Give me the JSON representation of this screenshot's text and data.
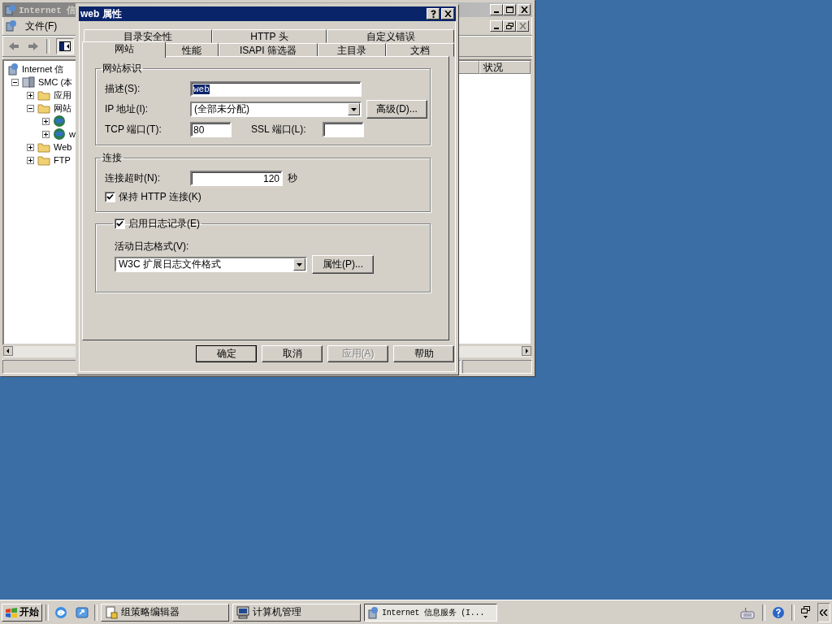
{
  "background_window": {
    "title": "Internet 信",
    "menu": [
      "文件(F)"
    ],
    "tree": [
      {
        "label": "Internet 信",
        "kind": "root",
        "children": [
          {
            "label": "SMC (本",
            "kind": "server",
            "expanded": true,
            "children": [
              {
                "label": "应用",
                "kind": "folder",
                "expanded": false
              },
              {
                "label": "网站",
                "kind": "folder",
                "expanded": true,
                "children": [
                  {
                    "kind": "site",
                    "expanded": false
                  },
                  {
                    "label": "w",
                    "kind": "site",
                    "expanded": false
                  }
                ]
              },
              {
                "label": "Web",
                "kind": "folder",
                "expanded": false
              },
              {
                "label": "FTP",
                "kind": "folder",
                "expanded": false
              }
            ]
          }
        ]
      }
    ],
    "columns": [
      "状况"
    ]
  },
  "dialog": {
    "title": "web 属性",
    "tab_rows": [
      [
        {
          "label": "目录安全性",
          "selected": false
        },
        {
          "label": "HTTP 头",
          "selected": false
        },
        {
          "label": "自定义错误",
          "selected": false
        }
      ],
      [
        {
          "label": "网站",
          "selected": true
        },
        {
          "label": "性能",
          "selected": false
        },
        {
          "label": "ISAPI 筛选器",
          "selected": false
        },
        {
          "label": "主目录",
          "selected": false
        },
        {
          "label": "文档",
          "selected": false
        }
      ]
    ],
    "site_identity": {
      "legend": "网站标识",
      "description_label": "描述(S):",
      "description_value": "web",
      "ip_label": "IP 地址(I):",
      "ip_value": "(全部未分配)",
      "advanced_button": "高级(D)...",
      "tcp_label": "TCP 端口(T):",
      "tcp_value": "80",
      "ssl_label": "SSL 端口(L):"
    },
    "connection": {
      "legend": "连接",
      "timeout_label": "连接超时(N):",
      "timeout_value": "120",
      "timeout_unit": "秒",
      "keepalive": {
        "label": "保持 HTTP 连接(K)",
        "checked": true
      }
    },
    "logging": {
      "enable": {
        "label": "启用日志记录(E)",
        "checked": true
      },
      "format_label": "活动日志格式(V):",
      "format_value": "W3C 扩展日志文件格式",
      "properties_button": "属性(P)..."
    },
    "buttons": [
      {
        "label": "确定",
        "default": true,
        "disabled": false
      },
      {
        "label": "取消",
        "default": false,
        "disabled": false
      },
      {
        "label": "应用(A)",
        "default": false,
        "disabled": true
      },
      {
        "label": "帮助",
        "default": false,
        "disabled": false
      }
    ]
  },
  "taskbar": {
    "start": "开始",
    "tasks": [
      {
        "label": "组策略编辑器",
        "kind": "policy",
        "selected": false
      },
      {
        "label": "计算机管理",
        "kind": "computer",
        "selected": false
      },
      {
        "label": "Internet 信息服务 (I...",
        "kind": "iis",
        "selected": true
      }
    ]
  }
}
